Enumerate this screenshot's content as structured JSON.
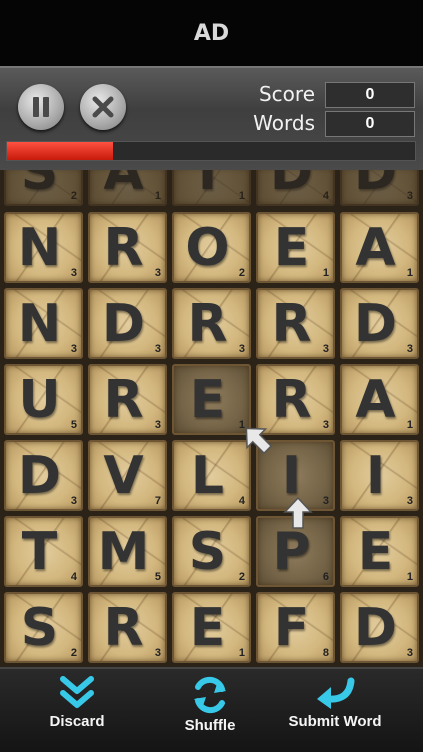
{
  "ad": {
    "text": "AD"
  },
  "hud": {
    "score_label": "Score",
    "words_label": "Words",
    "score_value": "0",
    "words_value": "0",
    "progress_fraction": 0.26,
    "progress_color": "#e0301e"
  },
  "board": {
    "ghost_row": [
      {
        "letter": "S",
        "points": "2"
      },
      {
        "letter": "A",
        "points": "1"
      },
      {
        "letter": "T",
        "points": "1"
      },
      {
        "letter": "D",
        "points": "4"
      },
      {
        "letter": "D",
        "points": "3"
      }
    ],
    "rows": [
      [
        {
          "letter": "N",
          "points": "3"
        },
        {
          "letter": "R",
          "points": "3"
        },
        {
          "letter": "O",
          "points": "2"
        },
        {
          "letter": "E",
          "points": "1"
        },
        {
          "letter": "A",
          "points": "1"
        }
      ],
      [
        {
          "letter": "N",
          "points": "3"
        },
        {
          "letter": "D",
          "points": "3"
        },
        {
          "letter": "R",
          "points": "3"
        },
        {
          "letter": "R",
          "points": "3"
        },
        {
          "letter": "D",
          "points": "3"
        }
      ],
      [
        {
          "letter": "U",
          "points": "5"
        },
        {
          "letter": "R",
          "points": "3"
        },
        {
          "letter": "E",
          "points": "1",
          "selected": true
        },
        {
          "letter": "R",
          "points": "3"
        },
        {
          "letter": "A",
          "points": "1"
        }
      ],
      [
        {
          "letter": "D",
          "points": "3"
        },
        {
          "letter": "V",
          "points": "7"
        },
        {
          "letter": "L",
          "points": "4"
        },
        {
          "letter": "I",
          "points": "3",
          "selected": true
        },
        {
          "letter": "I",
          "points": "3"
        }
      ],
      [
        {
          "letter": "T",
          "points": "4"
        },
        {
          "letter": "M",
          "points": "5"
        },
        {
          "letter": "S",
          "points": "2"
        },
        {
          "letter": "P",
          "points": "6",
          "selected": true
        },
        {
          "letter": "E",
          "points": "1"
        }
      ],
      [
        {
          "letter": "S",
          "points": "2"
        },
        {
          "letter": "R",
          "points": "3"
        },
        {
          "letter": "E",
          "points": "1"
        },
        {
          "letter": "F",
          "points": "8"
        },
        {
          "letter": "D",
          "points": "3"
        }
      ]
    ]
  },
  "actions": {
    "discard": "Discard",
    "shuffle": "Shuffle",
    "submit": "Submit Word",
    "accent": "#38c8e8"
  }
}
